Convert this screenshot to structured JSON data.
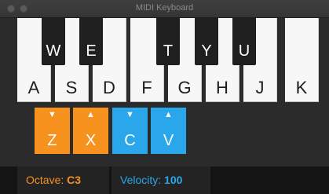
{
  "window": {
    "title": "MIDI Keyboard"
  },
  "keyboard": {
    "white_keys": [
      "A",
      "S",
      "D",
      "F",
      "G",
      "H",
      "J",
      "K"
    ],
    "black_keys": [
      "W",
      "E",
      "T",
      "Y",
      "U"
    ]
  },
  "controls": [
    {
      "label": "Z",
      "direction": "down",
      "color": "#f7921e"
    },
    {
      "label": "X",
      "direction": "up",
      "color": "#f7921e"
    },
    {
      "label": "C",
      "direction": "down",
      "color": "#2aa7ea"
    },
    {
      "label": "V",
      "direction": "up",
      "color": "#2aa7ea"
    }
  ],
  "status": {
    "octave_label": "Octave:",
    "octave_value": "C3",
    "velocity_label": "Velocity:",
    "velocity_value": "100"
  },
  "colors": {
    "octave_accent": "#f7921e",
    "velocity_accent": "#2aa7ea"
  }
}
